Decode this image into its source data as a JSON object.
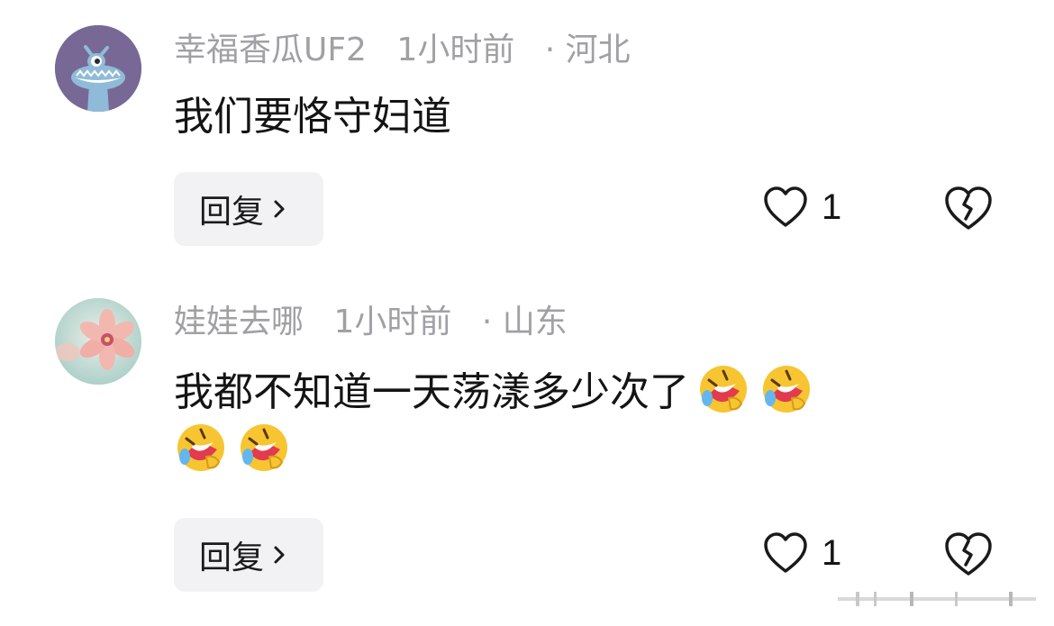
{
  "comments": [
    {
      "username": "幸福香瓜UF2",
      "time": "1小时前",
      "location": "· 河北",
      "text": "我们要恪守妇道",
      "emojis": [],
      "reply_label": "回复",
      "like_count": "1",
      "avatar_icon": "cartoon-monster-avatar"
    },
    {
      "username": "娃娃去哪",
      "time": "1小时前",
      "location": "· 山东",
      "text": "我都不知道一天荡漾多少次了",
      "emojis": [
        "rofl-emoji",
        "rofl-emoji",
        "rofl-emoji",
        "rofl-emoji"
      ],
      "reply_label": "回复",
      "like_count": "1",
      "avatar_icon": "pink-flower-avatar"
    }
  ],
  "colors": {
    "meta_text": "#a0a0a5",
    "reply_bg": "#f2f2f4",
    "avatar1_bg": "#7a6a9a",
    "emoji_yellow": "#f7c531"
  }
}
